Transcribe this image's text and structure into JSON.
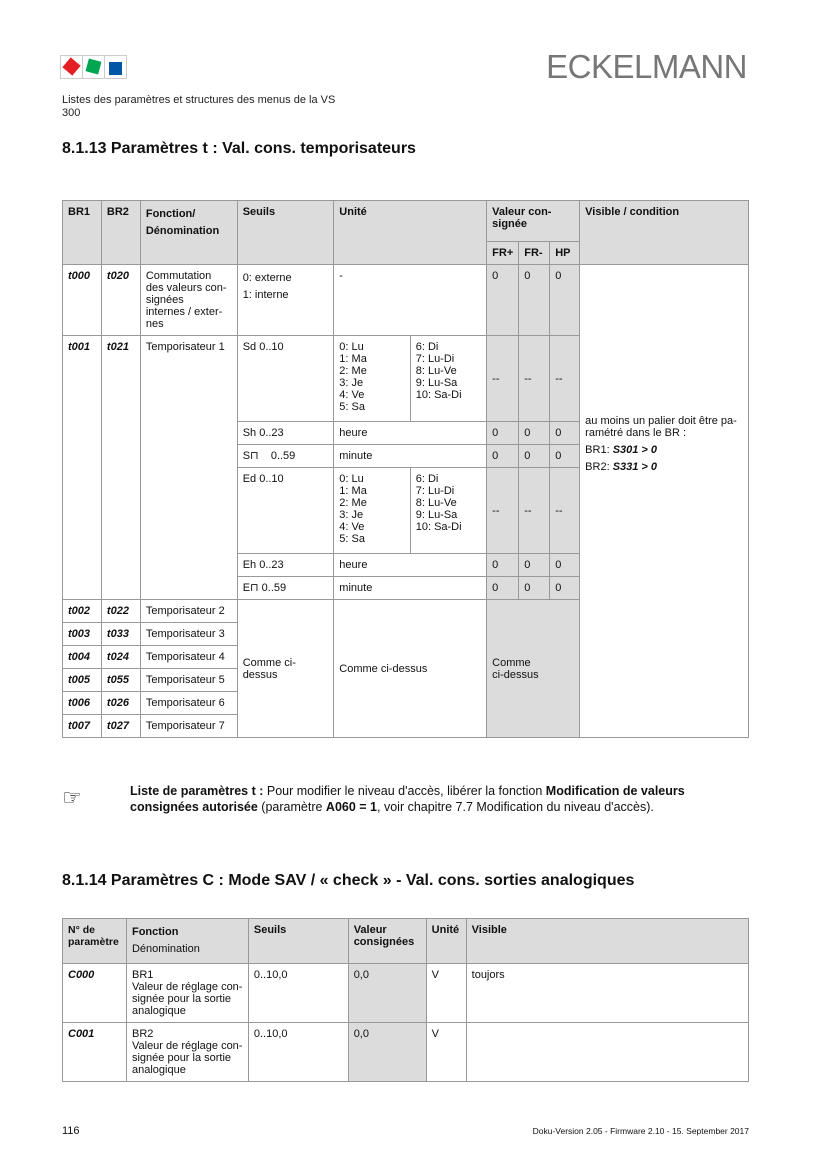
{
  "header": {
    "brand": "ECKELMANN",
    "logo_colors": [
      "#e31e24",
      "#00a650",
      "#0057a8"
    ],
    "subtitle_line1": "Listes des paramètres et structures des menus de la VS",
    "subtitle_line2": "300"
  },
  "section1": {
    "title": "8.1.13   Paramètres t : Val. cons. temporisateurs",
    "headers": {
      "br1": "BR1",
      "br2": "BR2",
      "fonction": "Fonction/",
      "denomination": "Dénomination",
      "seuils": "Seuils",
      "unite": "Unité",
      "valeur": "Valeur con-\nsignée",
      "fr_plus": "FR+",
      "fr_minus": "FR-",
      "hp": "HP",
      "visible": "Visible / condition"
    },
    "row_t000": {
      "br1": "t000",
      "br2": "t020",
      "fonction": "Commutation des valeurs con-\nsignées\ninternes / exter-\nnes",
      "seuils_1": "0: externe",
      "seuils_2": "1: interne",
      "unite": "-",
      "fr_plus": "0",
      "fr_minus": "0",
      "hp": "0"
    },
    "row_t001": {
      "br1": "t001",
      "br2": "t021",
      "fonction": "Temporisateur 1",
      "sub": [
        {
          "seuil": "Sd 0..10",
          "unite_a": "0: Lu\n1: Ma\n2: Me\n3: Je\n4: Ve\n5: Sa",
          "unite_b": "6: Di\n7: Lu-Di\n8: Lu-Ve\n9: Lu-Sa\n10: Sa-Di",
          "fr_plus": "--",
          "fr_minus": "--",
          "hp": "--"
        },
        {
          "seuil": "Sh 0..23",
          "unite": "heure",
          "fr_plus": "0",
          "fr_minus": "0",
          "hp": "0"
        },
        {
          "seuil": "S⊓    0..59",
          "unite": "minute",
          "fr_plus": "0",
          "fr_minus": "0",
          "hp": "0"
        },
        {
          "seuil": "Ed 0..10",
          "unite_a": "0: Lu\n1: Ma\n2: Me\n3: Je\n4: Ve\n5: Sa",
          "unite_b": "6: Di\n7: Lu-Di\n8: Lu-Ve\n9: Lu-Sa\n10: Sa-Di",
          "fr_plus": "--",
          "fr_minus": "--",
          "hp": "--"
        },
        {
          "seuil": "Eh 0..23",
          "unite": "heure",
          "fr_plus": "0",
          "fr_minus": "0",
          "hp": "0"
        },
        {
          "seuil": "E⊓ 0..59",
          "unite": "minute",
          "fr_plus": "0",
          "fr_minus": "0",
          "hp": "0"
        }
      ]
    },
    "visible_condition": {
      "text": "au moins un palier doit être pa-\nramétré dans le BR :",
      "br1_label": "BR1: ",
      "br1_value": "S301 > 0",
      "br2_label": "BR2: ",
      "br2_value": "S331 > 0"
    },
    "rows_other": [
      {
        "br1": "t002",
        "br2": "t022",
        "fonction": "Temporisateur 2"
      },
      {
        "br1": "t003",
        "br2": "t033",
        "fonction": "Temporisateur 3"
      },
      {
        "br1": "t004",
        "br2": "t024",
        "fonction": "Temporisateur 4"
      },
      {
        "br1": "t005",
        "br2": "t055",
        "fonction": "Temporisateur 5"
      },
      {
        "br1": "t006",
        "br2": "t026",
        "fonction": "Temporisateur 6"
      },
      {
        "br1": "t007",
        "br2": "t027",
        "fonction": "Temporisateur 7"
      }
    ],
    "same_as_above_seuils": "Comme ci-dessus",
    "same_as_above_unite": "Comme ci-dessus",
    "same_as_above_valeur": "Comme\nci-dessus"
  },
  "note": {
    "icon": "pointing-hand-icon",
    "bold1": "Liste de paramètres t :",
    "text1": " Pour modifier le niveau d'accès, libérer la fonction ",
    "bold2": "Modification de valeurs consignées autorisée",
    "text2": " (paramètre ",
    "bold3": "A060 = 1",
    "text3": ", voir chapitre 7.7 Modification du niveau d'accès)."
  },
  "section2": {
    "title": "8.1.14   Paramètres C : Mode SAV / « check » - Val. cons. sorties analogiques",
    "headers": {
      "num": "N° de\nparamètre",
      "fonction": "Fonction",
      "denomination": "Dénomination",
      "seuils": "Seuils",
      "valeur": "Valeur\nconsignées",
      "unite": "Unité",
      "visible": "Visible"
    },
    "rows": [
      {
        "num": "C000",
        "fonction": "BR1\nValeur de réglage con-\nsignée pour la sortie\nanalogique",
        "seuils": "0..10,0",
        "valeur": "0,0",
        "unite": "V",
        "visible": "toujors"
      },
      {
        "num": "C001",
        "fonction": "BR2\nValeur de réglage con-\nsignée pour la sortie\nanalogique",
        "seuils": "0..10,0",
        "valeur": "0,0",
        "unite": "V",
        "visible": ""
      }
    ]
  },
  "footer": {
    "page": "116",
    "version": "Doku-Version 2.05 - Firmware 2.10 - 15. September 2017"
  }
}
